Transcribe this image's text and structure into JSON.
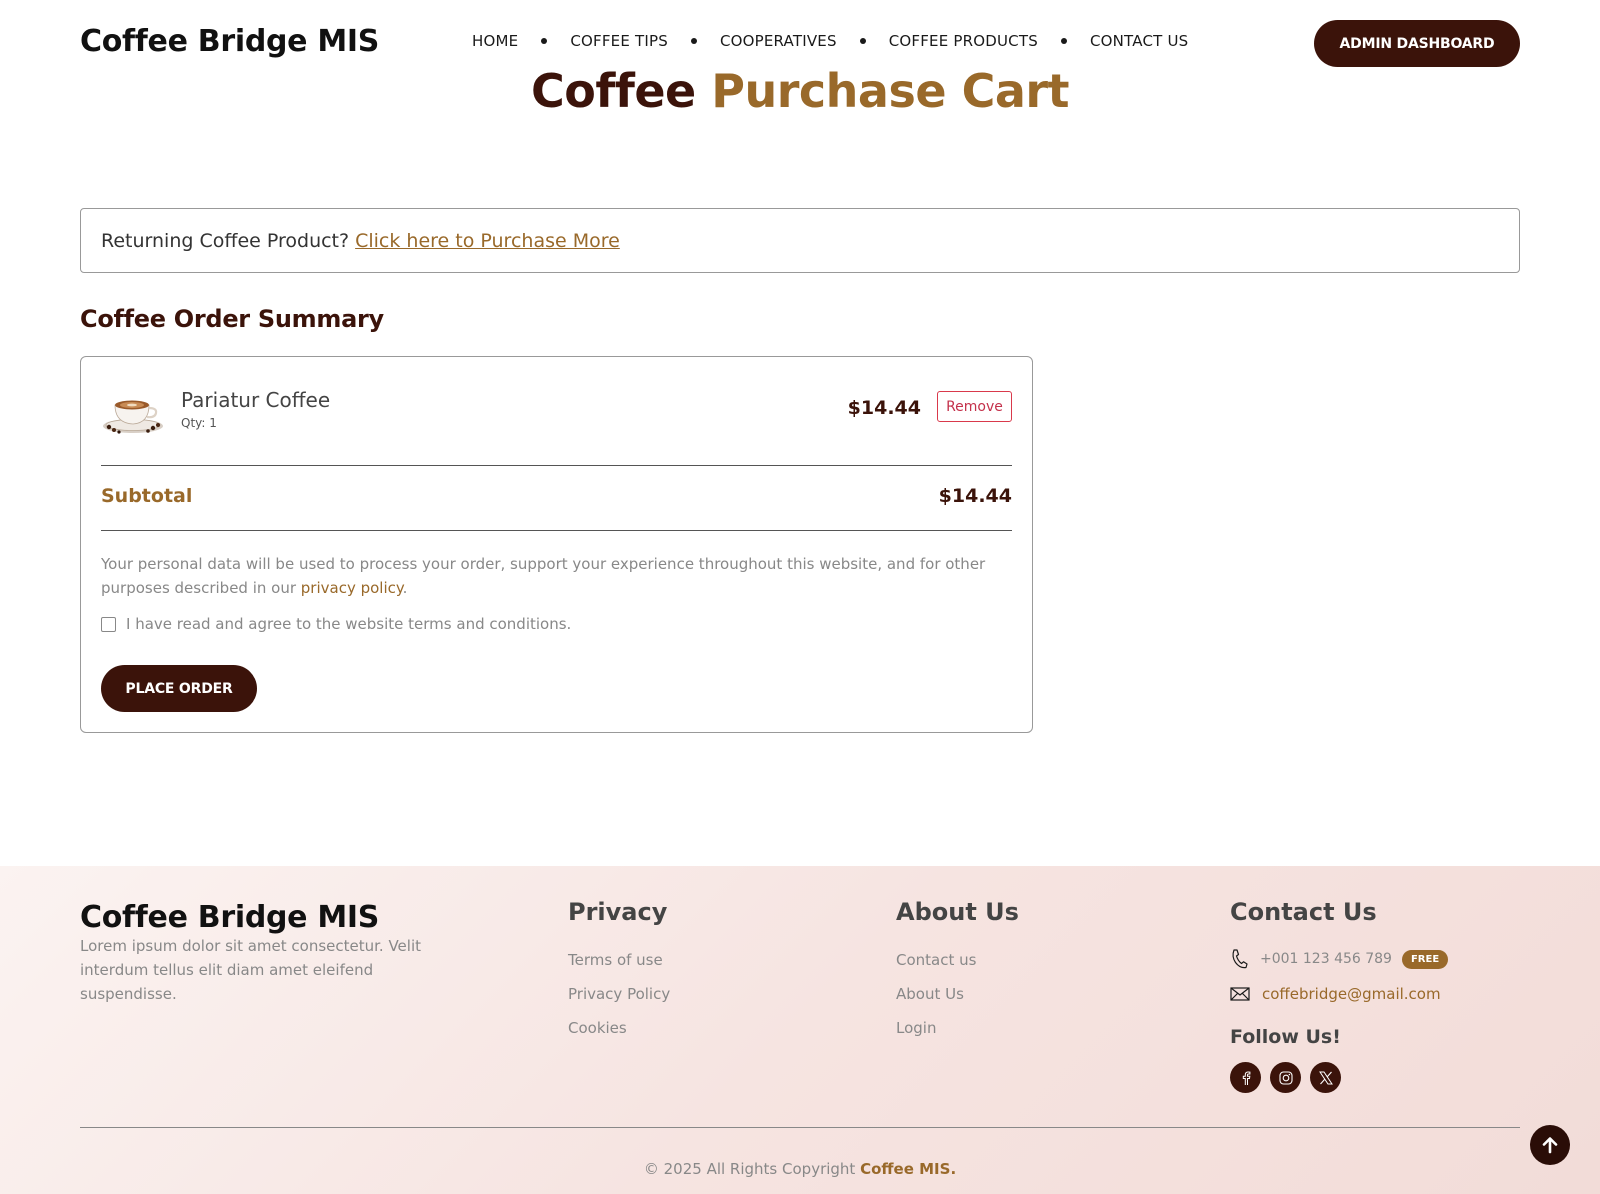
{
  "header": {
    "brand": "Coffee Bridge MIS",
    "nav": [
      {
        "label": "HOME"
      },
      {
        "label": "COFFEE TIPS"
      },
      {
        "label": "COOPERATIVES"
      },
      {
        "label": "COFFEE PRODUCTS"
      },
      {
        "label": "CONTACT US"
      }
    ],
    "admin_button": "ADMIN DASHBOARD"
  },
  "page_title": {
    "part1": "Coffee",
    "part2": "Purchase Cart"
  },
  "notice": {
    "text": "Returning Coffee Product?",
    "link": "Click here to Purchase More"
  },
  "summary": {
    "heading": "Coffee Order Summary",
    "items": [
      {
        "name": "Pariatur Coffee",
        "qty": "Qty: 1",
        "price": "$14.44",
        "remove_label": "Remove",
        "image_icon": "coffee-cup-image"
      }
    ],
    "subtotal_label": "Subtotal",
    "subtotal_value": "$14.44",
    "privacy_text": "Your personal data will be used to process your order, support your experience throughout this website, and for other purposes described in our",
    "privacy_link": "privacy policy",
    "privacy_end": ".",
    "agree_label": "I have read and agree to the website terms and conditions.",
    "agree_checked": false,
    "place_order": "PLACE ORDER"
  },
  "footer": {
    "brand": "Coffee Bridge MIS",
    "description": "Lorem ipsum dolor sit amet consectetur. Velit interdum tellus elit diam amet eleifend suspendisse.",
    "privacy": {
      "title": "Privacy",
      "links": [
        "Terms of use",
        "Privacy Policy",
        "Cookies"
      ]
    },
    "about": {
      "title": "About Us",
      "links": [
        "Contact us",
        "About Us",
        "Login"
      ]
    },
    "contact": {
      "title": "Contact Us",
      "phone": "+001 123 456 789",
      "phone_badge": "FREE",
      "email": "coffebridge@gmail.com",
      "follow": "Follow Us!",
      "socials": [
        "facebook-icon",
        "instagram-icon",
        "x-twitter-icon"
      ]
    },
    "copyright_text": "© 2025 All Rights Copyright",
    "copyright_brand": "Coffee MIS."
  },
  "colors": {
    "primary_dark": "#3b130a",
    "accent": "#99692a",
    "danger": "#c4314b"
  }
}
